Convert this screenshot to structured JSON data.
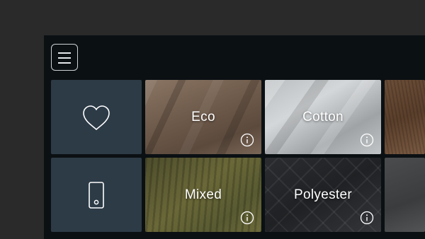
{
  "menu": {
    "icon": "hamburger-menu-icon"
  },
  "quick_tiles": [
    {
      "icon": "heart-icon",
      "description": "favorites"
    },
    {
      "icon": "smartphone-icon",
      "description": "device"
    }
  ],
  "categories": [
    {
      "label": "Eco",
      "info_icon": "info-icon"
    },
    {
      "label": "Cotton",
      "info_icon": "info-icon"
    },
    {
      "label": "Mixed",
      "info_icon": "info-icon"
    },
    {
      "label": "Polyester",
      "info_icon": "info-icon"
    }
  ],
  "colors": {
    "background": "#2a2a2a",
    "panel": "#0b1013",
    "quick_tile": "#2d3b47",
    "text": "#ffffff"
  }
}
